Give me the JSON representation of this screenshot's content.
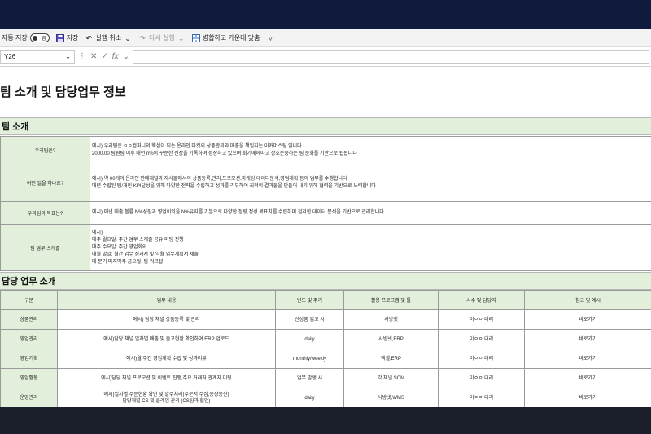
{
  "toolbar": {
    "autosave_label": "자동 저장",
    "autosave_state": "끔",
    "save_label": "저장",
    "undo_label": "실행 취소",
    "redo_label": "다시 실행",
    "merge_label": "병합하고 가운데 맞춤"
  },
  "formula_bar": {
    "cell_ref": "Y26",
    "fx_label": "fx",
    "formula_value": ""
  },
  "sheet": {
    "title": "팀 소개 및 담당업무 정보",
    "section1_title": "팀 소개",
    "intro_rows": [
      {
        "label": "우리팀은?",
        "text": "예시) 우리팀은 ㅇㅇ컴퍼니의 핵심이 되는 온라인 마켓의 상품관리와 매출을 책임지는 이커머스팀 입니다\n2000.00 팀원팀 이후 매년 n%의 꾸준한 신장을 기록하며 성장하고 있으며 회기에에따고 상호존중하는 팀 문화를 기반으로 됩됩니다"
      },
      {
        "label": "어떤 일을 하나요?",
        "text": "예시) 약 00개의 온라인 판매채널과 자사몰에서의 상품등록,관리,프로모션,마케팅,데이터분석,영업계획 등의 업무를 수행합니다\n매년 수립된 팀/개인 KPI달성을 위해 다양한 전략을 수립하고 성과를 리뷰하여 최적의 결과물을 만들어 내기 위해 협력을 기반으로 노력합니다"
      },
      {
        "label": "우리팀의 목표는?",
        "text": "예시) 매년 매출 볼륨 N%성장과 영업이익을 N%유지를 기본으로 다양한 정량,정성 목표치를 수립하며 철저한 데이터 분석을 기반으로 관리합니다"
      },
      {
        "label": "팀 업무 스케줄",
        "text": "예시)\n매주 월요일: 주간 업무 스케줄 공유 미팅 진행\n매주 수요일: 주간 영업회의\n매월 말일: 월간 업무 성과서 및 익월 업무계획서 제출\n매 분기 마지막주 금요일: 팀 워크샵"
      }
    ],
    "section2_title": "담당 업무 소개",
    "duty_headers": [
      "구분",
      "업무 내용",
      "빈도 및 주기",
      "활용 프로그램 및 툴",
      "사수 및 담당자",
      "참고 및 예시"
    ],
    "duty_rows": [
      [
        "상품관리",
        "예시) 담당 채널 상품등록 및 관리",
        "신상품 입고 시",
        "사방넷",
        "이ㅇㅇ 대리",
        "바로가기"
      ],
      [
        "영업관리",
        "예시)담당 채널 일자별 매출 및 출고현황 확인하여 ERP 업로드",
        "daily",
        "사방넷,ERP",
        "이ㅇㅇ 대리",
        "바로가기"
      ],
      [
        "영업기획",
        "예시)월/주간 영업계획 수립 및 성과리뷰",
        "monthly/weekly",
        "엑셀,ERP",
        "이ㅇㅇ 대리",
        "바로가기"
      ],
      [
        "영업활동",
        "예시)담당 채널 프로모션 및 이벤트 진행,주요 거래처 관계자 미팅",
        "업무 발생 시",
        "각 채널 SCM",
        "이ㅇㅇ 대리",
        "바로가기"
      ],
      [
        "운영관리",
        "예시)일자별 주문현황 확인 및 발주처리(주문서 수집,송장송신)\n담당채널 CS 및 클레임 관리 (CS팀과 협업)",
        "daily",
        "사방넷,WMS",
        "이ㅇㅇ 대리",
        "바로가기"
      ]
    ]
  }
}
